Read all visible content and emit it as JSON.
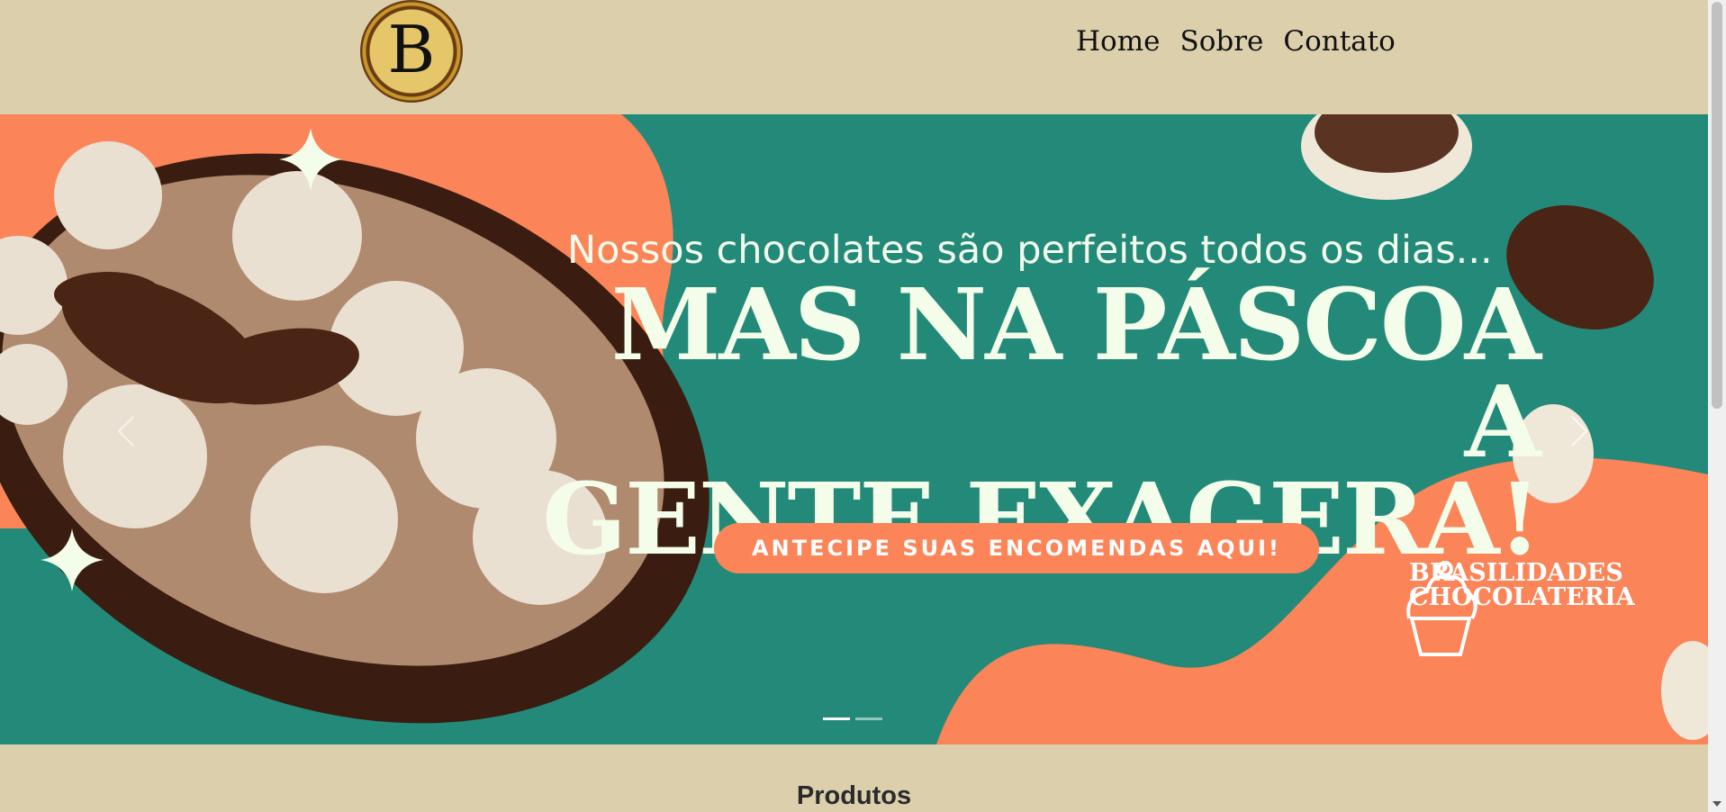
{
  "header": {
    "logo_letter": "B",
    "nav": [
      {
        "label": "Home"
      },
      {
        "label": "Sobre"
      },
      {
        "label": "Contato"
      }
    ]
  },
  "carousel": {
    "subtitle": "Nossos chocolates são perfeitos todos os dias...",
    "title_line1": "MAS NA PÁSCOA A",
    "title_line2": "GENTE EXAGERA!",
    "cta_label": "ANTECIPE SUAS ENCOMENDAS AQUI!",
    "brand_line1": "BRASILIDADES",
    "brand_line2": "CHOCOLATERIA",
    "slides_count": 2,
    "active_slide": 1,
    "colors": {
      "teal": "#238a7a",
      "orange": "#fb8458",
      "cream": "#f4fde9"
    }
  },
  "section": {
    "title": "Produtos"
  },
  "icons": {
    "prev": "chevron-left-icon",
    "next": "chevron-right-icon"
  }
}
